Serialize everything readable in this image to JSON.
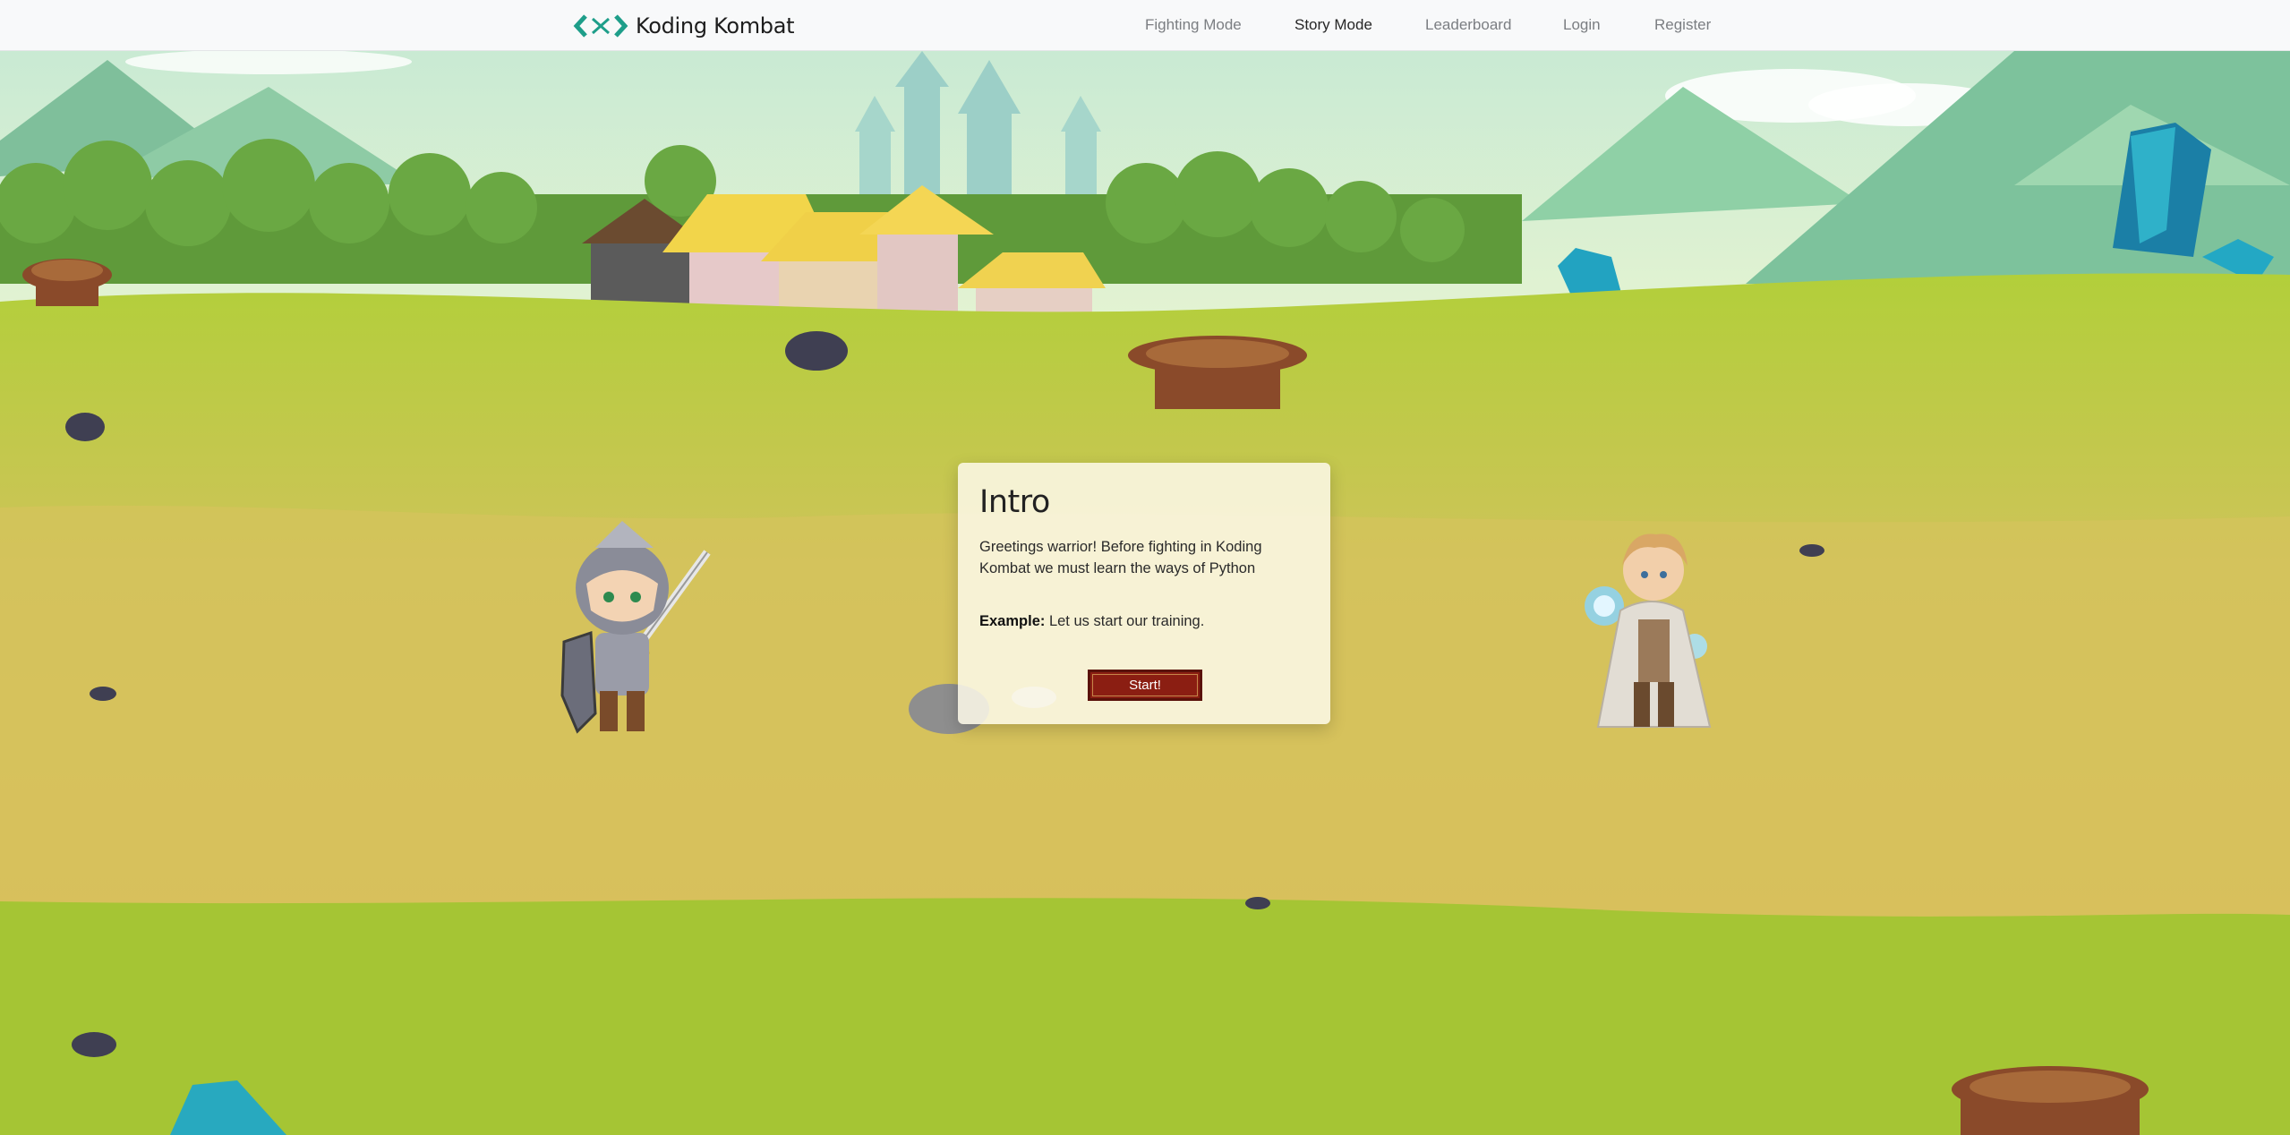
{
  "brand": {
    "name": "Koding Kombat",
    "logo_icon": "koding-kombat-logo-icon",
    "logo_color": "#1e9e8a"
  },
  "nav": {
    "links": [
      {
        "label": "Fighting Mode",
        "active": false
      },
      {
        "label": "Story Mode",
        "active": true
      },
      {
        "label": "Leaderboard",
        "active": false
      },
      {
        "label": "Login",
        "active": false
      },
      {
        "label": "Register",
        "active": false
      }
    ]
  },
  "dialog": {
    "title": "Intro",
    "body": "Greetings warrior! Before fighting in Koding Kombat we must learn the ways of Python",
    "example_label": "Example:",
    "example_text": " Let us start our training.",
    "button_label": "Start!"
  },
  "scene": {
    "player_icon": "knight-character-icon",
    "opponent_icon": "mage-character-icon",
    "button_color": "#8b1e12"
  }
}
